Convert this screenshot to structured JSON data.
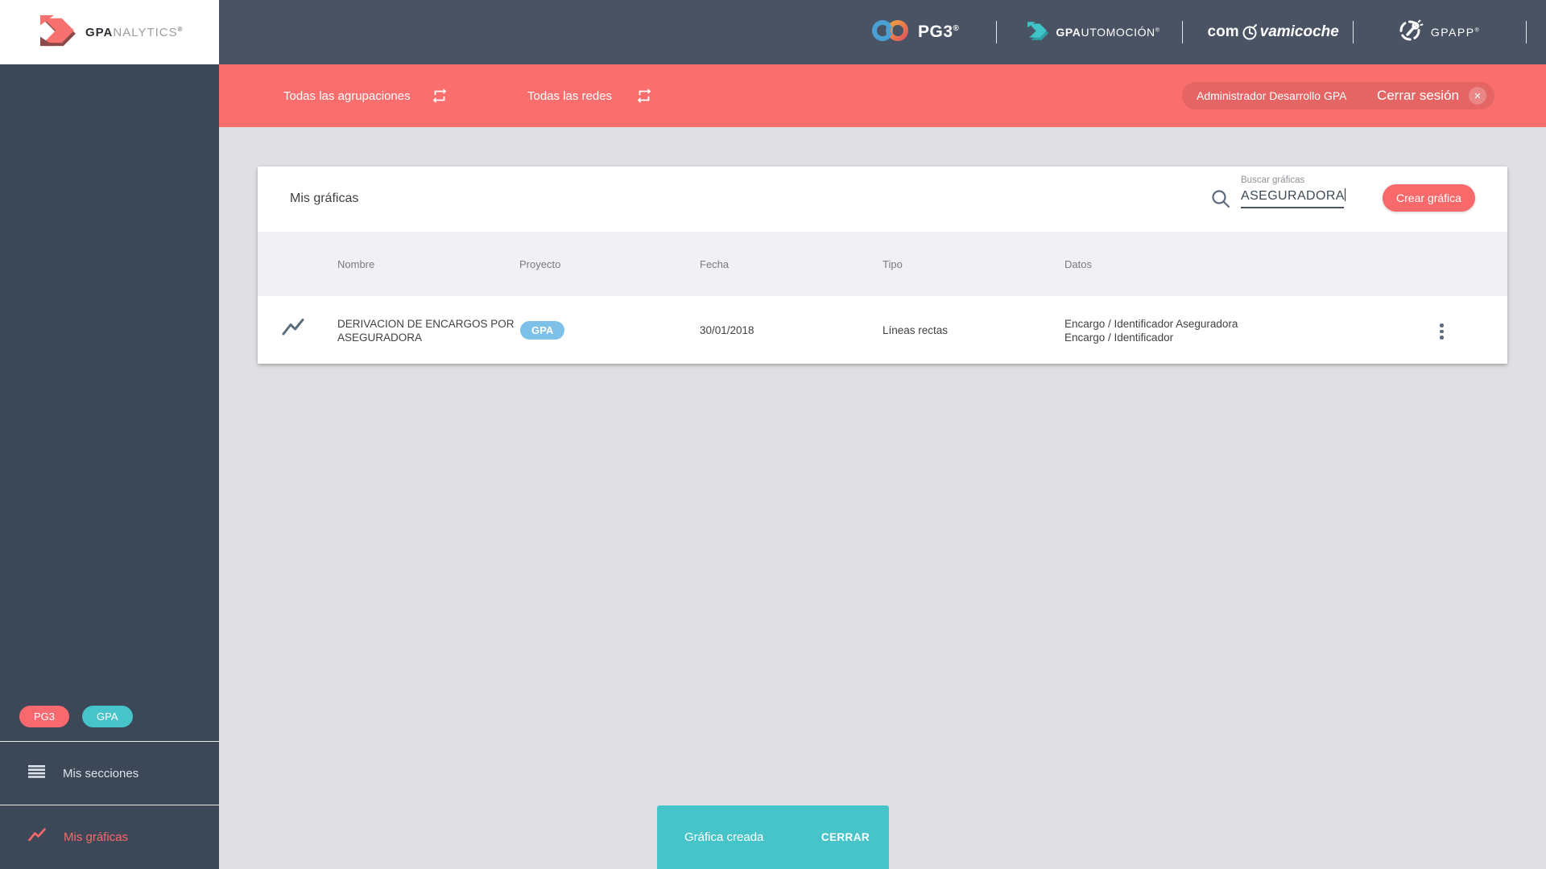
{
  "header": {
    "logo": {
      "bold": "GPA",
      "light": "NALYTICS",
      "reg": "®"
    },
    "brands": {
      "pg3": {
        "label": "PG3",
        "reg": "®"
      },
      "gpautomocion": {
        "bold": "GPA",
        "light": "UTOMOCIÓN",
        "reg": "®"
      },
      "comvamicoche": {
        "prefix": "com",
        "suffix": "vamicoche"
      },
      "gpapp": {
        "label": "GPAPP",
        "reg": "®"
      }
    }
  },
  "filter_bar": {
    "groupings_label": "Todas las agrupaciones",
    "networks_label": "Todas las redes",
    "user_name": "Administrador Desarrollo GPA",
    "logout_label": "Cerrar sesión",
    "logout_x": "✕"
  },
  "sidebar": {
    "badges": [
      {
        "label": "PG3"
      },
      {
        "label": "GPA"
      }
    ],
    "items": [
      {
        "label": "Mis secciones"
      },
      {
        "label": "Mis gráficas"
      }
    ]
  },
  "card": {
    "title": "Mis gráficas",
    "search": {
      "label": "Buscar gráficas",
      "value": "ASEGURADORA"
    },
    "create_button": "Crear gráfica",
    "table": {
      "headers": [
        "Nombre",
        "Proyecto",
        "Fecha",
        "Tipo",
        "Datos"
      ],
      "rows": [
        {
          "name": "DERIVACION DE ENCARGOS POR ASEGURADORA",
          "project_badge": "GPA",
          "date": "30/01/2018",
          "type": "Líneas rectas",
          "data": [
            "Encargo / Identificador Aseguradora",
            "Encargo / Identificador"
          ]
        }
      ]
    }
  },
  "toast": {
    "message": "Gráfica creada",
    "action": "CERRAR"
  },
  "colors": {
    "accent_red": "#fb6e6e",
    "button_red": "#f7696b",
    "teal": "#46c4c9",
    "badge_blue": "#7dc1e8",
    "header_dark": "#4a5363",
    "sidebar_dark": "#3c4757",
    "page_bg": "#e0e0e4"
  }
}
